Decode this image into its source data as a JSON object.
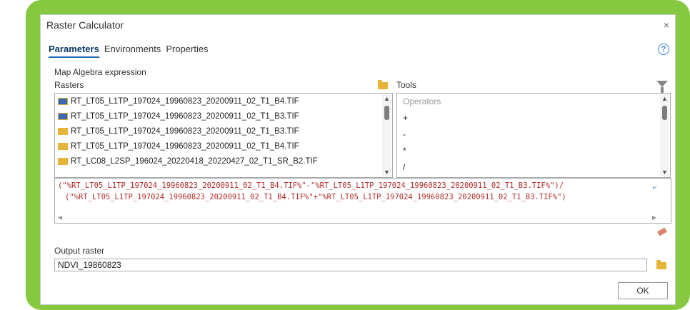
{
  "window": {
    "title": "Raster Calculator",
    "close": "×"
  },
  "tabs": [
    {
      "label": "Parameters"
    },
    {
      "label": "Environments"
    },
    {
      "label": "Properties"
    }
  ],
  "help": "?",
  "labels": {
    "map_algebra": "Map Algebra expression",
    "rasters": "Rasters",
    "tools": "Tools",
    "output_raster": "Output raster"
  },
  "rasters": [
    {
      "name": "RT_LT05_L1TP_197024_19960823_20200911_02_T1_B4.TIF",
      "icon": "raster-layer-icon"
    },
    {
      "name": "RT_LT05_L1TP_197024_19960823_20200911_02_T1_B3.TIF",
      "icon": "raster-layer-icon"
    },
    {
      "name": "RT_LT05_L1TP_197024_19960823_20200911_02_T1_B3.TIF",
      "icon": "raster-file-icon"
    },
    {
      "name": "RT_LT05_L1TP_197024_19960823_20200911_02_T1_B4.TIF",
      "icon": "raster-file-icon"
    },
    {
      "name": "RT_LC08_L2SP_196024_20220418_20220427_02_T1_SR_B2.TIF",
      "icon": "raster-file-icon"
    }
  ],
  "operators": {
    "header": "Operators",
    "items": [
      "+",
      "-",
      "*",
      "/"
    ]
  },
  "expression": {
    "line1": "(\"%RT_LT05_L1TP_197024_19960823_20200911_02_T1_B4.TIF%\"-\"%RT_LT05_L1TP_197024_19960823_20200911_02_T1_B3.TIF%\")/",
    "line2": "(\"%RT_LT05_L1TP_197024_19960823_20200911_02_T1_B4.TIF%\"+\"%RT_LT05_L1TP_197024_19960823_20200911_02_T1_B3.TIF%\")"
  },
  "output": {
    "value": "NDVI_19860823"
  },
  "buttons": {
    "ok": "OK"
  },
  "colors": {
    "frame": "#86c840",
    "accent": "#1f6fb8",
    "expression_text": "#b22b2b",
    "folder": "#e7b43a"
  }
}
